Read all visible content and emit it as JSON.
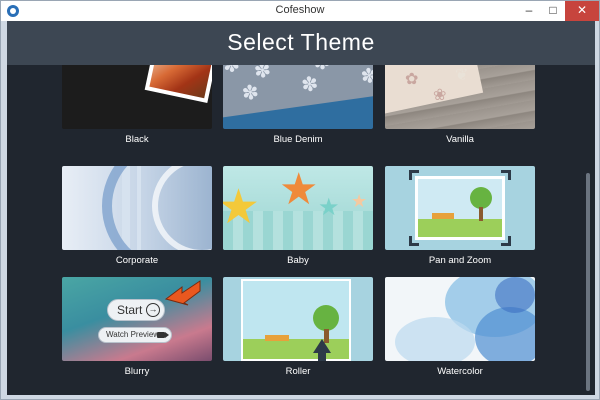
{
  "window": {
    "title": "Cofeshow",
    "minimize_glyph": "–",
    "maximize_glyph": "□",
    "close_glyph": "✕"
  },
  "header": {
    "title": "Select Theme"
  },
  "themes": [
    {
      "label": "Black"
    },
    {
      "label": "Blue Denim"
    },
    {
      "label": "Vanilla"
    },
    {
      "label": "Corporate"
    },
    {
      "label": "Baby"
    },
    {
      "label": "Pan and Zoom"
    },
    {
      "label": "Blurry"
    },
    {
      "label": "Roller"
    },
    {
      "label": "Watercolor"
    }
  ],
  "hover": {
    "start_label": "Start",
    "start_glyph": "→",
    "preview_label": "Watch Preview"
  },
  "colors": {
    "header_bg": "#3d4753",
    "content_bg": "#20262f",
    "pointer_arrow": "#e9581f",
    "close_button": "#c7443d"
  },
  "icons": [
    "app-icon",
    "start-arrow-icon",
    "camera-icon",
    "pointer-arrow-icon"
  ]
}
